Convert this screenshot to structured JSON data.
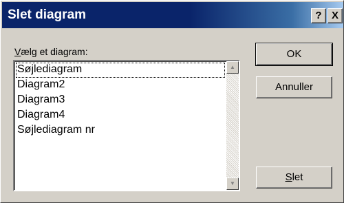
{
  "window": {
    "title": "Slet diagram",
    "help_glyph": "?",
    "close_glyph": "X"
  },
  "prompt": {
    "label_accel": "V",
    "label_rest": "ælg et diagram:"
  },
  "list": {
    "items": [
      "Søjlediagram",
      "Diagram2",
      "Diagram3",
      "Diagram4",
      "Søjlediagram nr"
    ],
    "selected_index": 0
  },
  "scrollbar": {
    "up_glyph": "▲",
    "down_glyph": "▼"
  },
  "buttons": {
    "ok_label": "OK",
    "cancel_label": "Annuller",
    "delete_accel": "S",
    "delete_rest": "let"
  },
  "colors": {
    "titlebar_start": "#0a246a",
    "titlebar_end": "#a6caf0",
    "face": "#d4d0c8"
  }
}
